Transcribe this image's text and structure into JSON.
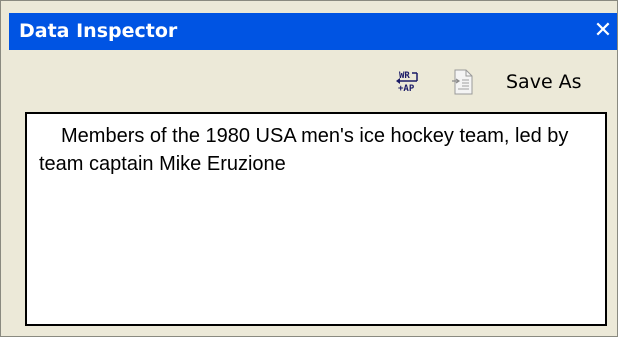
{
  "window": {
    "title": "Data Inspector",
    "close_glyph": "✕"
  },
  "toolbar": {
    "wrap_icon": "word-wrap-icon",
    "export_icon": "export-document-icon",
    "save_as_label": "Save As"
  },
  "content": {
    "text": "Members of the 1980 USA men's ice hockey team, led by team captain Mike Eruzione"
  },
  "colors": {
    "titlebar": "#0054e3",
    "panel": "#ece9d8",
    "content_bg": "#ffffff"
  }
}
